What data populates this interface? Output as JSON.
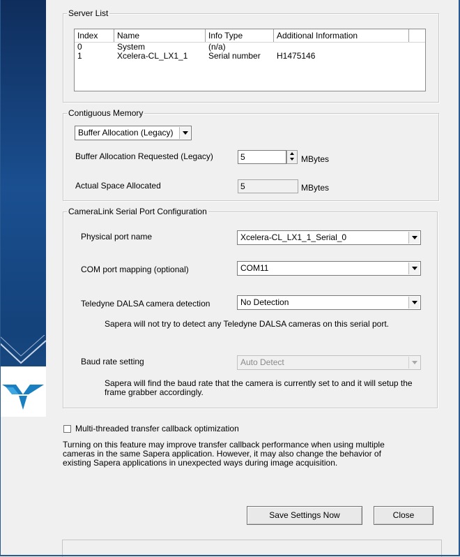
{
  "server_list": {
    "legend": "Server List",
    "columns": [
      "Index",
      "Name",
      "Info Type",
      "Additional Information"
    ],
    "rows": [
      [
        "0",
        "System",
        "(n/a)",
        ""
      ],
      [
        "1",
        "Xcelera-CL_LX1_1",
        "Serial number",
        "H1475146"
      ]
    ]
  },
  "contiguous_memory": {
    "legend": "Contiguous Memory",
    "mode_select": "Buffer Allocation (Legacy)",
    "requested_label": "Buffer Allocation Requested (Legacy)",
    "requested_value": "5",
    "requested_unit": "MBytes",
    "actual_label": "Actual Space Allocated",
    "actual_value": "5",
    "actual_unit": "MBytes"
  },
  "cameralink": {
    "legend": "CameraLink Serial Port Configuration",
    "port_label": "Physical port name",
    "port_value": "Xcelera-CL_LX1_1_Serial_0",
    "com_label": "COM port mapping (optional)",
    "com_value": "COM11",
    "detect_label": "Teledyne DALSA camera detection",
    "detect_value": "No Detection",
    "detect_note": "Sapera will not try to detect any Teledyne DALSA cameras on this serial port.",
    "baud_label": "Baud rate setting",
    "baud_value": "Auto Detect",
    "baud_note_1": "Sapera will find the baud rate that the camera is currently set to and it will setup the",
    "baud_note_2": "frame grabber accordingly."
  },
  "multithread": {
    "checkbox_label": "Multi-threaded transfer callback optimization",
    "checked": false,
    "note_1": "Turning on this feature may improve transfer callback performance when using multiple",
    "note_2": "cameras in the same Sapera application. However, it may also change the behavior of",
    "note_3": "existing Sapera applications in unexpected ways during image acquisition."
  },
  "buttons": {
    "save": "Save Settings Now",
    "close": "Close"
  },
  "branding": {
    "strip_color": "#14427a",
    "logo_color": "#1a7fc0",
    "logo_icon": "teledyne-logo-icon"
  }
}
